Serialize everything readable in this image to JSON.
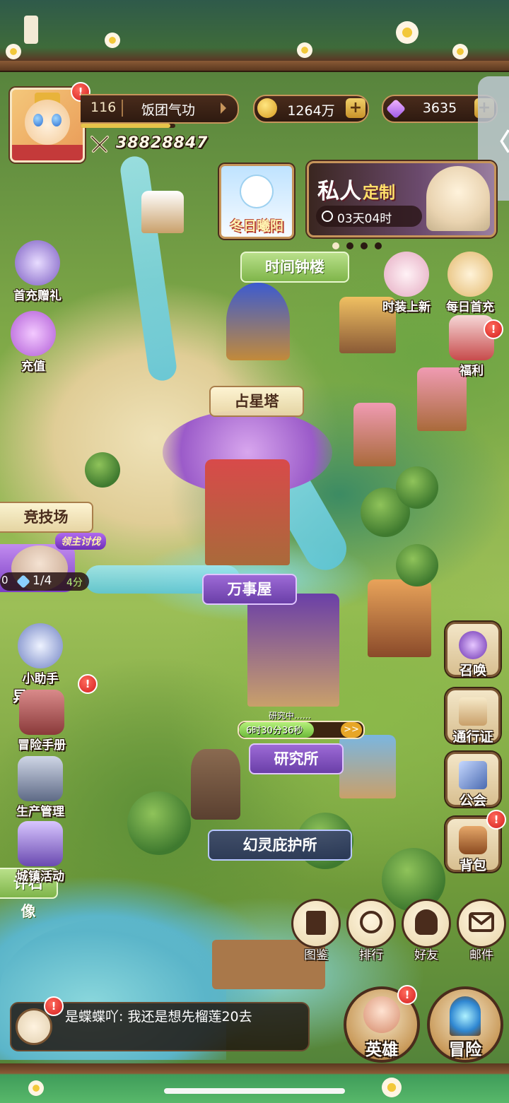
{
  "player": {
    "level": "116",
    "name": "饭团气功",
    "power": "38828847",
    "exp_fraction": 0.95
  },
  "currency": {
    "gold": "1264万",
    "gems": "3635",
    "plus": "+"
  },
  "collapse": {
    "glyph": "〈"
  },
  "events": {
    "winter": "冬日曦阳",
    "private_title": "私人",
    "private_title2": "定制",
    "private_timer": "03天04时",
    "carousel_pages": 4,
    "carousel_active": 0
  },
  "map_labels": {
    "clock_tower": "时间钟楼",
    "astral_tower": "占星塔",
    "arena": "竞技场",
    "general_store": "万事屋",
    "research": "研究所",
    "shelter": "幻灵庇护所",
    "statue": "许石像"
  },
  "research": {
    "status": "研究中……",
    "time": "6时30分36秒",
    "speed": ">>",
    "progress": 0.6
  },
  "lord": {
    "tag": "领主讨伐",
    "count": "1/4",
    "timer": "4分",
    "left_timer": "0"
  },
  "left_buttons": [
    {
      "label": "首充赠礼",
      "icon": "gift-box-icon"
    },
    {
      "label": "充值",
      "icon": "recharge-icon"
    },
    {
      "label": "小助手",
      "icon": "robot-helper-icon"
    },
    {
      "label": "冒险手册",
      "icon": "adventure-book-icon"
    },
    {
      "label": "生产管理",
      "icon": "production-icon"
    },
    {
      "label": "城镇活动",
      "icon": "town-event-icon"
    }
  ],
  "left_partial": "异",
  "top_right_buttons": [
    {
      "label": "时装上新",
      "icon": "fashion-icon"
    },
    {
      "label": "每日首充",
      "icon": "daily-charge-icon"
    },
    {
      "label": "福利",
      "icon": "welfare-icon"
    }
  ],
  "right_buttons": [
    {
      "label": "召唤",
      "icon": "summon-icon"
    },
    {
      "label": "通行证",
      "icon": "pass-icon"
    },
    {
      "label": "公会",
      "icon": "guild-icon"
    },
    {
      "label": "背包",
      "icon": "backpack-icon"
    }
  ],
  "bottom_icons": [
    {
      "label": "图鉴",
      "icon": "codex-icon"
    },
    {
      "label": "排行",
      "icon": "ranking-icon"
    },
    {
      "label": "好友",
      "icon": "friends-icon"
    },
    {
      "label": "邮件",
      "icon": "mail-icon"
    }
  ],
  "chat": {
    "text": "是蝶蝶吖: 我还是想先榴莲20去"
  },
  "big_buttons": {
    "hero": "英雄",
    "adventure": "冒险"
  },
  "alert": "!",
  "colors": {
    "frame_brown": "#4a2c1c",
    "gold_border": "#c7955b",
    "alert_red": "#d41f1f",
    "purple_label": "#6a3fa8"
  }
}
